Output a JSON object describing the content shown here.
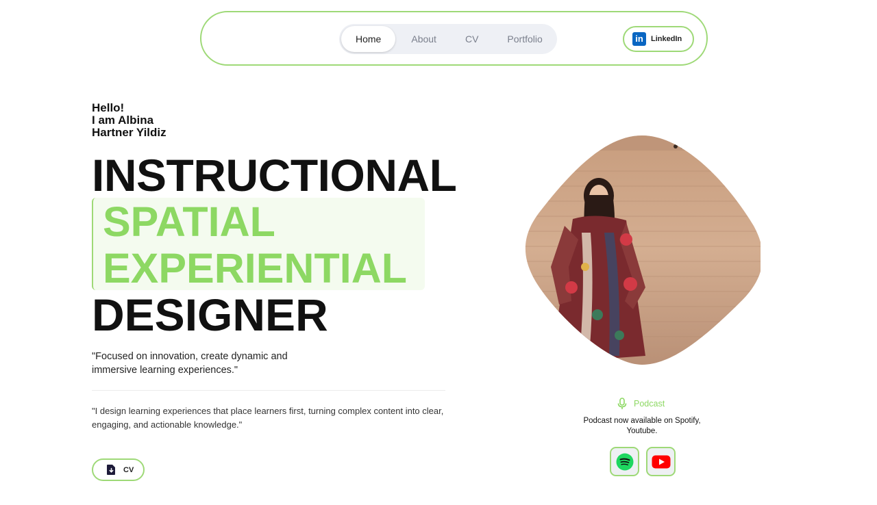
{
  "nav": {
    "items": [
      {
        "label": "Home",
        "active": true
      },
      {
        "label": "About",
        "active": false
      },
      {
        "label": "CV",
        "active": false
      },
      {
        "label": "Portfolio",
        "active": false
      }
    ],
    "linkedin_label": "LinkedIn",
    "linkedin_icon": "linkedin-icon"
  },
  "hero": {
    "greeting": [
      "Hello!",
      "I am Albina",
      "Hartner Yildiz"
    ],
    "title_line1": "INSTRUCTIONAL",
    "highlight_line1": "SPATIAL",
    "highlight_line2": "EXPERIENTIAL",
    "title_line4": "DESIGNER",
    "tagline": "\"Focused on innovation, create dynamic and immersive learning experiences.\"",
    "bio_line1": "\"I design learning experiences that place learners first, turning complex content into clear,",
    "bio_line2": "engaging, and actionable knowledge.\"",
    "cv_button": "CV"
  },
  "podcast": {
    "label": "Podcast",
    "description": "Podcast now available on Spotify, Youtube.",
    "links": [
      "spotify-icon",
      "youtube-icon"
    ]
  },
  "colors": {
    "accent_green": "#8dd863",
    "border_green": "#9ed977",
    "linkedin_blue": "#0a66c2",
    "spotify_green": "#1ed760",
    "youtube_red": "#ff0000"
  }
}
